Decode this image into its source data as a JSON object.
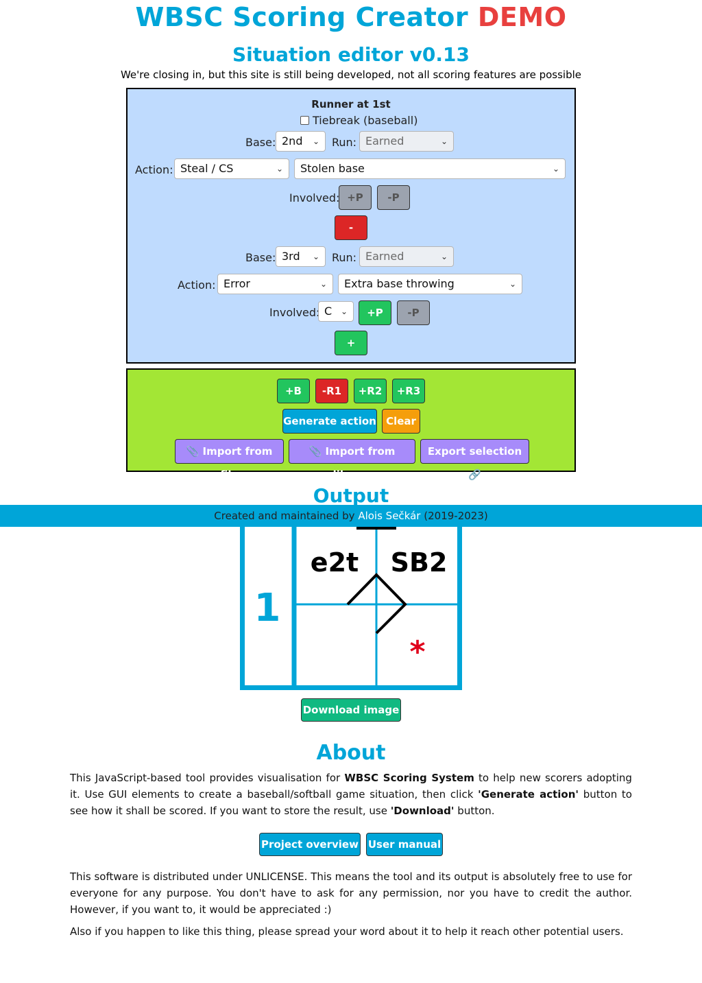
{
  "header": {
    "title": "WBSC Scoring Creator",
    "demo": "DEMO",
    "subtitle": "Situation editor v0.13",
    "note": "We're closing in, but this site is still being developed, not all scoring features are possible"
  },
  "runner_panel": {
    "heading": "Runner at 1st",
    "tiebreak_label": "Tiebreak (baseball)",
    "tiebreak_checked": false,
    "base_label": "Base:",
    "run_label": "Run:",
    "action_label": "Action:",
    "involved_label": "Involved:",
    "action1": {
      "base": "2nd",
      "run": "Earned",
      "type": "Steal / CS",
      "detail": "Stolen base",
      "add_player": "+P",
      "remove_player": "-P",
      "remove_action": "-"
    },
    "action2": {
      "base": "3rd",
      "run": "Earned",
      "type": "Error",
      "detail": "Extra base throwing",
      "involved_player": "C",
      "add_player": "+P",
      "remove_player": "-P",
      "add_action": "+"
    }
  },
  "controls": {
    "add_batter": "+B",
    "remove_r1": "-R1",
    "add_r2": "+R2",
    "add_r3": "+R3",
    "generate": "Generate action",
    "clear": "Clear",
    "import_file": "📎 Import from file",
    "import_library": "📎 Import from library",
    "export": "Export selection 🔗"
  },
  "output": {
    "heading": "Output",
    "batter_number": "1",
    "cell_top_left": "e2t",
    "cell_top_right": "SB2",
    "marker": "*",
    "download": "Download image"
  },
  "footer": {
    "prefix": "Created and maintained by",
    "author": "Alois Sečkár",
    "years": "(2019-2023)"
  },
  "about": {
    "heading": "About",
    "p1_a": "This JavaScript-based tool provides visualisation for",
    "p1_b": "WBSC Scoring System",
    "p1_c": "to help new scorers adopting it. Use GUI elements to create a baseball/softball game situation, then click",
    "p1_d": "'Generate action'",
    "p1_e": "button to see how it shall be scored. If you want to store the result, use",
    "p1_f": "'Download'",
    "p1_g": "button.",
    "project_overview": "Project overview",
    "user_manual": "User manual",
    "p2": "This software is distributed under UNLICENSE. This means the tool and its output is absolutely free to use for everyone for any purpose. You don't have to ask for any permission, nor you have to credit the author. However, if you want to, it would be appreciated :)",
    "p3": "Also if you happen to like this thing, please spread your word about it to help it reach other potential users."
  },
  "colors": {
    "accent": "#00A5D8",
    "demo": "#E8403E",
    "panel_blue": "#BFDBFE",
    "panel_green": "#A3E635"
  }
}
